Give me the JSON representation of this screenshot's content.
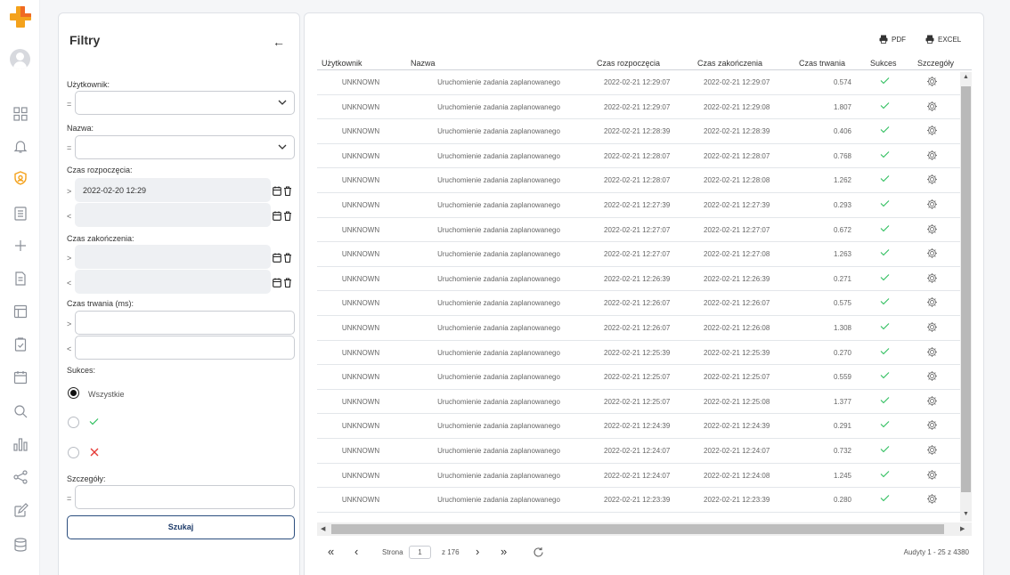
{
  "colors": {
    "accent": "#f4a21c",
    "success": "#2fbf5e",
    "error": "#e53935",
    "brand_dark": "#1f3d6b"
  },
  "rail": {
    "icons": [
      "logo-icon",
      "avatar",
      "dashboard-icon",
      "bell-icon",
      "shield-icon",
      "list-icon",
      "plus-icon",
      "document-icon",
      "layout-icon",
      "clipboard-check-icon",
      "calendar-icon",
      "search-icon",
      "bar-chart-icon",
      "share-icon",
      "edit-icon",
      "database-icon"
    ]
  },
  "filters": {
    "title": "Filtry",
    "user_label": "Użytkownik:",
    "user_op": "=",
    "name_label": "Nazwa:",
    "name_op": "=",
    "start_label": "Czas rozpoczęcia:",
    "start_gt_op": ">",
    "start_gt_value": "2022-02-20 12:29",
    "start_lt_op": "<",
    "end_label": "Czas zakończenia:",
    "end_gt_op": ">",
    "end_lt_op": "<",
    "duration_label": "Czas trwania (ms):",
    "duration_gt_op": ">",
    "duration_lt_op": "<",
    "success_label": "Sukces:",
    "success_all": "Wszystkie",
    "details_label": "Szczegóły:",
    "details_op": "=",
    "search_button": "Szukaj"
  },
  "toolbar": {
    "pdf": "PDF",
    "excel": "EXCEL"
  },
  "table": {
    "columns": [
      "Użytkownik",
      "Nazwa",
      "Czas rozpoczęcia",
      "Czas zakończenia",
      "Czas trwania",
      "Sukces",
      "Szczegóły"
    ],
    "rows": [
      [
        "UNKNOWN",
        "Uruchomienie zadania zaplanowanego",
        "2022-02-21 12:29:07",
        "2022-02-21 12:29:07",
        "0.574"
      ],
      [
        "UNKNOWN",
        "Uruchomienie zadania zaplanowanego",
        "2022-02-21 12:29:07",
        "2022-02-21 12:29:08",
        "1.807"
      ],
      [
        "UNKNOWN",
        "Uruchomienie zadania zaplanowanego",
        "2022-02-21 12:28:39",
        "2022-02-21 12:28:39",
        "0.406"
      ],
      [
        "UNKNOWN",
        "Uruchomienie zadania zaplanowanego",
        "2022-02-21 12:28:07",
        "2022-02-21 12:28:07",
        "0.768"
      ],
      [
        "UNKNOWN",
        "Uruchomienie zadania zaplanowanego",
        "2022-02-21 12:28:07",
        "2022-02-21 12:28:08",
        "1.262"
      ],
      [
        "UNKNOWN",
        "Uruchomienie zadania zaplanowanego",
        "2022-02-21 12:27:39",
        "2022-02-21 12:27:39",
        "0.293"
      ],
      [
        "UNKNOWN",
        "Uruchomienie zadania zaplanowanego",
        "2022-02-21 12:27:07",
        "2022-02-21 12:27:07",
        "0.672"
      ],
      [
        "UNKNOWN",
        "Uruchomienie zadania zaplanowanego",
        "2022-02-21 12:27:07",
        "2022-02-21 12:27:08",
        "1.263"
      ],
      [
        "UNKNOWN",
        "Uruchomienie zadania zaplanowanego",
        "2022-02-21 12:26:39",
        "2022-02-21 12:26:39",
        "0.271"
      ],
      [
        "UNKNOWN",
        "Uruchomienie zadania zaplanowanego",
        "2022-02-21 12:26:07",
        "2022-02-21 12:26:07",
        "0.575"
      ],
      [
        "UNKNOWN",
        "Uruchomienie zadania zaplanowanego",
        "2022-02-21 12:26:07",
        "2022-02-21 12:26:08",
        "1.308"
      ],
      [
        "UNKNOWN",
        "Uruchomienie zadania zaplanowanego",
        "2022-02-21 12:25:39",
        "2022-02-21 12:25:39",
        "0.270"
      ],
      [
        "UNKNOWN",
        "Uruchomienie zadania zaplanowanego",
        "2022-02-21 12:25:07",
        "2022-02-21 12:25:07",
        "0.559"
      ],
      [
        "UNKNOWN",
        "Uruchomienie zadania zaplanowanego",
        "2022-02-21 12:25:07",
        "2022-02-21 12:25:08",
        "1.377"
      ],
      [
        "UNKNOWN",
        "Uruchomienie zadania zaplanowanego",
        "2022-02-21 12:24:39",
        "2022-02-21 12:24:39",
        "0.291"
      ],
      [
        "UNKNOWN",
        "Uruchomienie zadania zaplanowanego",
        "2022-02-21 12:24:07",
        "2022-02-21 12:24:07",
        "0.732"
      ],
      [
        "UNKNOWN",
        "Uruchomienie zadania zaplanowanego",
        "2022-02-21 12:24:07",
        "2022-02-21 12:24:08",
        "1.245"
      ],
      [
        "UNKNOWN",
        "Uruchomienie zadania zaplanowanego",
        "2022-02-21 12:23:39",
        "2022-02-21 12:23:39",
        "0.280"
      ]
    ]
  },
  "pager": {
    "page_label": "Strona",
    "page_value": "1",
    "of_label": "z 176",
    "summary": "Audyty 1 - 25 z 4380"
  }
}
